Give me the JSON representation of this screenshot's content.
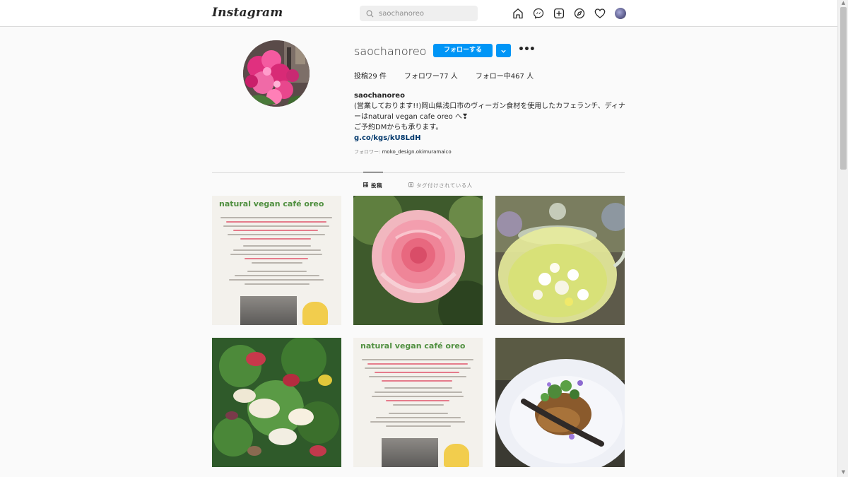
{
  "header": {
    "logo": "Instagram",
    "search_text": "saochanoreo",
    "icons": [
      "home-icon",
      "messenger-icon",
      "new-post-icon",
      "explore-icon",
      "activity-heart-icon",
      "profile-avatar"
    ]
  },
  "profile": {
    "username": "saochanoreo",
    "follow_label": "フォローする",
    "posts_stat": "投稿29 件",
    "followers_stat": "フォロワー77 人",
    "following_stat": "フォロー中467 人",
    "bio_name": "saochanoreo",
    "bio_line1": "(営業しております!!)岡山県浅口市のヴィーガン食材を使用したカフェランチ、ディナ",
    "bio_line2": "ーはnatural vegan cafe oreo へ❣",
    "bio_line3": "ご予約DMからも承ります。",
    "bio_link": "g.co/kgs/kU8LdH",
    "followed_by_label": "フォロワー: ",
    "followed_by_user": "moko_design.okimuramaico"
  },
  "tabs": {
    "posts": "投稿",
    "tagged": "タグ付けされている人"
  },
  "posts": {
    "flyer_title": "natural vegan café oreo"
  },
  "colors": {
    "accent": "#0095f6",
    "link": "#00376b",
    "background": "#fafafa"
  }
}
